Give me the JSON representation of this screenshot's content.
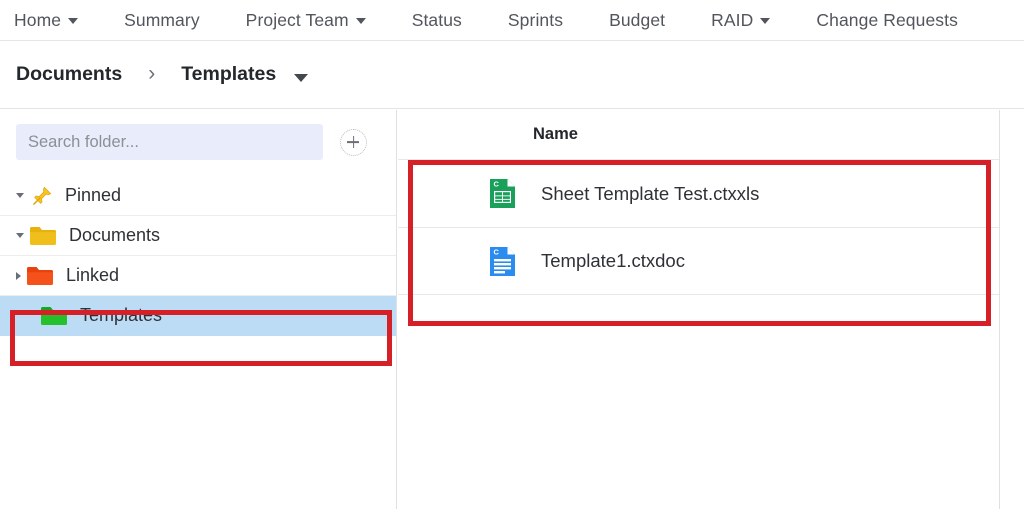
{
  "topnav": {
    "items": [
      {
        "label": "Home",
        "has_caret": true
      },
      {
        "label": "Summary",
        "has_caret": false
      },
      {
        "label": "Project Team",
        "has_caret": true
      },
      {
        "label": "Status",
        "has_caret": false
      },
      {
        "label": "Sprints",
        "has_caret": false
      },
      {
        "label": "Budget",
        "has_caret": false
      },
      {
        "label": "RAID",
        "has_caret": true
      },
      {
        "label": "Change Requests",
        "has_caret": false
      }
    ]
  },
  "breadcrumb": {
    "root": "Documents",
    "separator": "›",
    "current": "Templates"
  },
  "sidebar": {
    "search": {
      "placeholder": "Search folder...",
      "value": ""
    },
    "add_button_label": "+",
    "tree": [
      {
        "label": "Pinned",
        "icon": "pushpin-icon",
        "icon_color": "#f5c518",
        "state": "open",
        "indent": 0,
        "selected": false
      },
      {
        "label": "Documents",
        "icon": "folder-icon",
        "icon_color": "#e8b20e",
        "state": "open",
        "indent": 0,
        "selected": false
      },
      {
        "label": "Linked",
        "icon": "folder-icon",
        "icon_color": "#f54b15",
        "state": "closed",
        "indent": 1,
        "selected": false
      },
      {
        "label": "Templates",
        "icon": "folder-icon",
        "icon_color": "#22bb2a",
        "state": "none",
        "indent": 2,
        "selected": true
      }
    ]
  },
  "filelist": {
    "column_header": "Name",
    "rows": [
      {
        "name": "Sheet Template Test.ctxxls",
        "icon": "spreadsheet-file-icon",
        "icon_color": "#19a05a",
        "icon_letter": "C"
      },
      {
        "name": "Template1.ctxdoc",
        "icon": "document-file-icon",
        "icon_color": "#2b8cef",
        "icon_letter": "C"
      }
    ]
  },
  "annotations": {
    "highlight_color": "#d52027",
    "boxes": [
      {
        "name": "templates-folder-highlight"
      },
      {
        "name": "file-list-highlight"
      }
    ]
  },
  "colors": {
    "selection_blue": "#bcdcf6",
    "search_bg": "#e9edfb",
    "annotation_red": "#d52027"
  }
}
